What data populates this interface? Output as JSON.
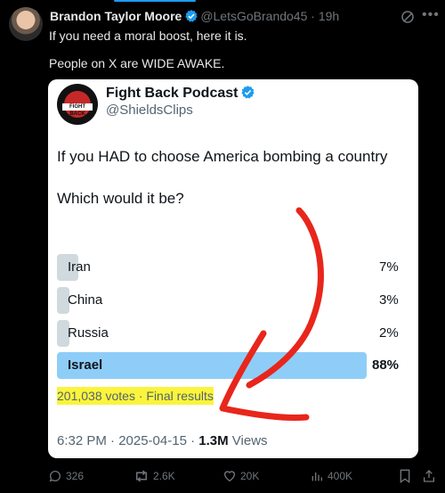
{
  "tweet": {
    "author_name": "Brandon Taylor Moore",
    "author_handle": "@LetsGoBrando45",
    "separator": "·",
    "time": "19h",
    "text_line1": "If you need a moral boost, here it is.",
    "text_line2": "People on X are WIDE AWAKE."
  },
  "quoted": {
    "name": "Fight Back Podcast",
    "handle": "@ShieldsClips",
    "avatar_text": "FIGHT BACK",
    "question_line1": "If you HAD to choose America bombing a country",
    "question_line2": "Which would it be?",
    "options": [
      {
        "label": "Iran",
        "pct": "7%",
        "value": 7
      },
      {
        "label": "China",
        "pct": "3%",
        "value": 3
      },
      {
        "label": "Russia",
        "pct": "2%",
        "value": 2
      },
      {
        "label": "Israel",
        "pct": "88%",
        "value": 88,
        "winner": true
      }
    ],
    "votes": "201,038 votes · Final results",
    "meta_time": "6:32 PM · 2025-04-15 · ",
    "meta_views_count": "1.3M",
    "meta_views_label": " Views"
  },
  "actions": {
    "replies": "326",
    "reposts": "2.6K",
    "likes": "20K",
    "views": "400K"
  },
  "colors": {
    "accent": "#1d9bf0",
    "winner_bar": "#8ecdf8",
    "bar": "#cfd9de",
    "highlight": "#fbf43c",
    "annotation": "#e8261b"
  },
  "icons": [
    "verified-icon",
    "grok-icon",
    "more-icon",
    "reply-icon",
    "repost-icon",
    "like-icon",
    "views-icon",
    "bookmark-icon",
    "share-icon"
  ]
}
